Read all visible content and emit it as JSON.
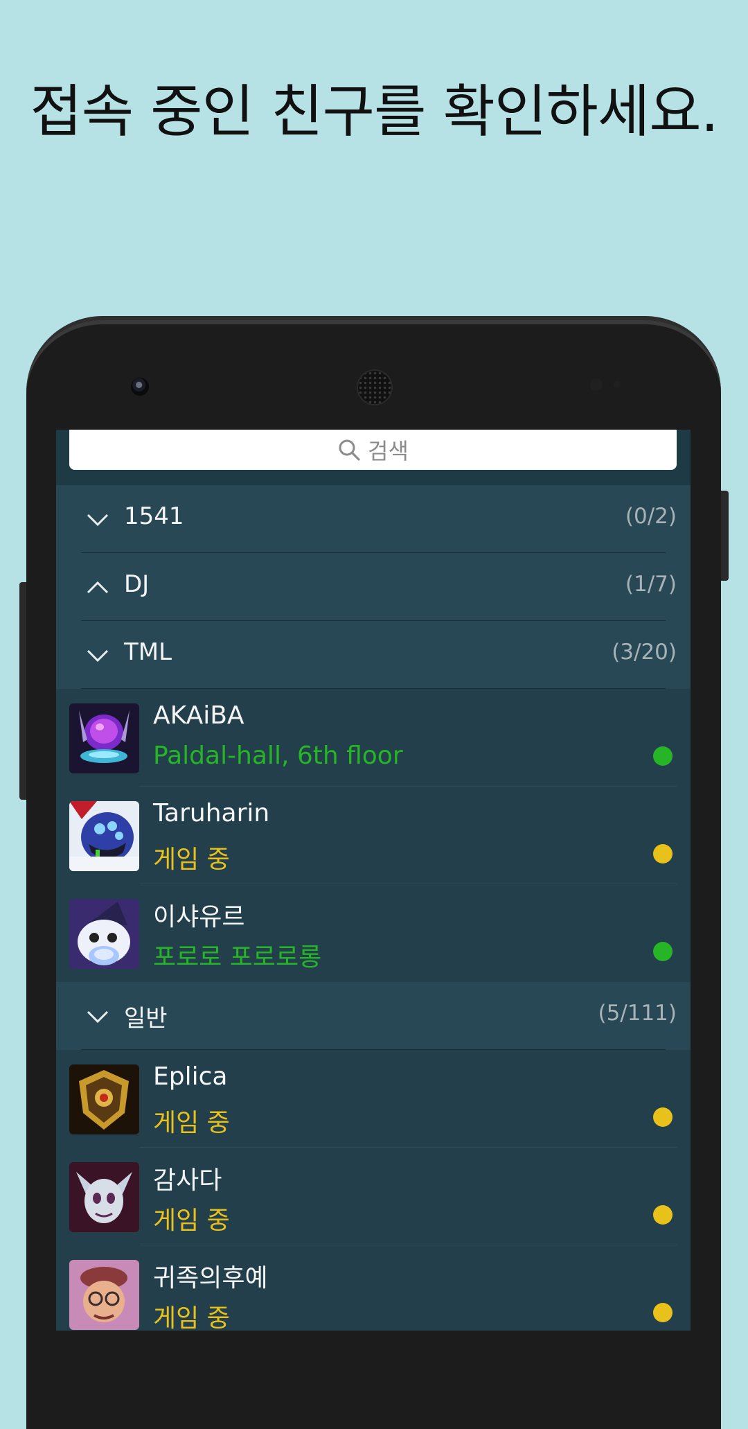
{
  "headline": "접속 중인 친구를 확인하세요.",
  "search": {
    "placeholder": "검색",
    "icon": "search-icon"
  },
  "colors": {
    "online": "#26b526",
    "in_game": "#e8c21b",
    "background": "#b6e2e6",
    "list_bg": "#233f4b",
    "group_bg": "#284856"
  },
  "groups": [
    {
      "name": "1541",
      "count": "(0/2)",
      "expanded": false,
      "icon": "chevron-down-icon"
    },
    {
      "name": "DJ",
      "count": "(1/7)",
      "expanded": true,
      "icon": "chevron-up-icon"
    },
    {
      "name": "TML",
      "count": "(3/20)",
      "expanded": false,
      "icon": "chevron-down-icon"
    },
    {
      "name": "일반",
      "count": "(5/111)",
      "expanded": false,
      "icon": "chevron-down-icon"
    }
  ],
  "friends_tml": [
    {
      "name": "AKAiBA",
      "status": "Paldal-hall, 6th floor",
      "state": "online"
    },
    {
      "name": "Taruharin",
      "status": "게임 중",
      "state": "in_game"
    },
    {
      "name": "이샤유르",
      "status": "포로로 포로로롱",
      "state": "online"
    }
  ],
  "friends_general": [
    {
      "name": "Eplica",
      "status": "게임 중",
      "state": "in_game"
    },
    {
      "name": "감사다",
      "status": "게임 중",
      "state": "in_game"
    },
    {
      "name": "귀족의후예",
      "status": "게임 중",
      "state": "in_game"
    }
  ]
}
